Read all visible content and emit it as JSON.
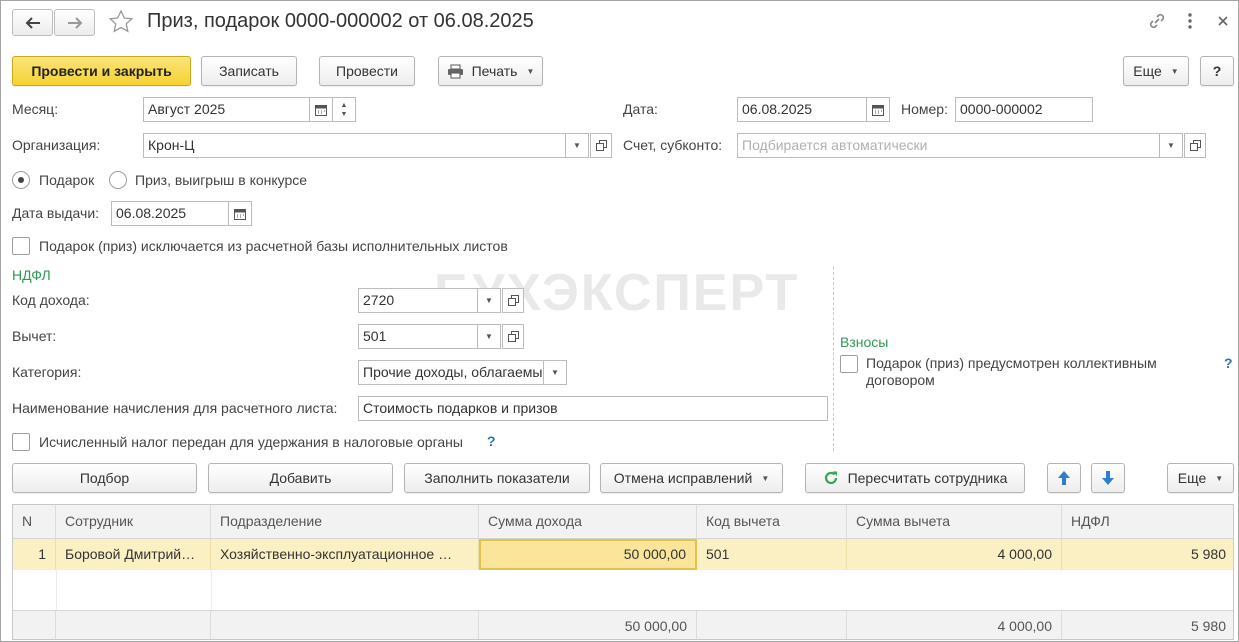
{
  "window": {
    "title": "Приз, подарок 0000-000002 от 06.08.2025"
  },
  "toolbar": {
    "post_close": "Провести и закрыть",
    "save": "Записать",
    "post": "Провести",
    "print": "Печать",
    "more": "Еще",
    "help": "?"
  },
  "form": {
    "month_label": "Месяц:",
    "month_value": "Август 2025",
    "date_label": "Дата:",
    "date_value": "06.08.2025",
    "number_label": "Номер:",
    "number_value": "0000-000002",
    "org_label": "Организация:",
    "org_value": "Крон-Ц",
    "account_label": "Счет, субконто:",
    "account_placeholder": "Подбирается автоматически",
    "radio_gift": "Подарок",
    "radio_prize": "Приз, выигрыш в конкурсе",
    "issue_date_label": "Дата выдачи:",
    "issue_date_value": "06.08.2025",
    "exclude_checkbox": "Подарок (приз) исключается из расчетной базы исполнительных листов"
  },
  "ndfl": {
    "section": "НДФЛ",
    "income_code_label": "Код дохода:",
    "income_code_value": "2720",
    "deduction_label": "Вычет:",
    "deduction_value": "501",
    "category_label": "Категория:",
    "category_value": "Прочие доходы, облагаемые",
    "accrual_name_label": "Наименование начисления для расчетного листа:",
    "accrual_name_value": "Стоимость подарков и призов",
    "tax_transferred": "Исчисленный налог передан для удержания в налоговые органы",
    "help": "?"
  },
  "contributions": {
    "section": "Взносы",
    "collective_line1": "Подарок (приз) предусмотрен коллективным",
    "collective_line2": "договором",
    "help": "?"
  },
  "watermark": "БУХЭКСПЕРТ",
  "table_toolbar": {
    "pick": "Подбор",
    "add": "Добавить",
    "fill": "Заполнить показатели",
    "cancel_corrections": "Отмена исправлений",
    "recalc": "Пересчитать сотрудника",
    "more": "Еще"
  },
  "table": {
    "columns": [
      "N",
      "Сотрудник",
      "Подразделение",
      "Сумма дохода",
      "Код вычета",
      "Сумма вычета",
      "НДФЛ"
    ],
    "rows": [
      [
        "1",
        "Боровой Дмитрий…",
        "Хозяйственно-эксплуатационное …",
        "50 000,00",
        "501",
        "4 000,00",
        "5 980"
      ]
    ],
    "totals": [
      "",
      "",
      "",
      "50 000,00",
      "",
      "4 000,00",
      "5 980"
    ]
  },
  "colors": {
    "primary_button": "#f5d331",
    "selected_row": "#fbf0c3",
    "section_header": "#2f9a53",
    "link_help": "#2c73b8"
  }
}
